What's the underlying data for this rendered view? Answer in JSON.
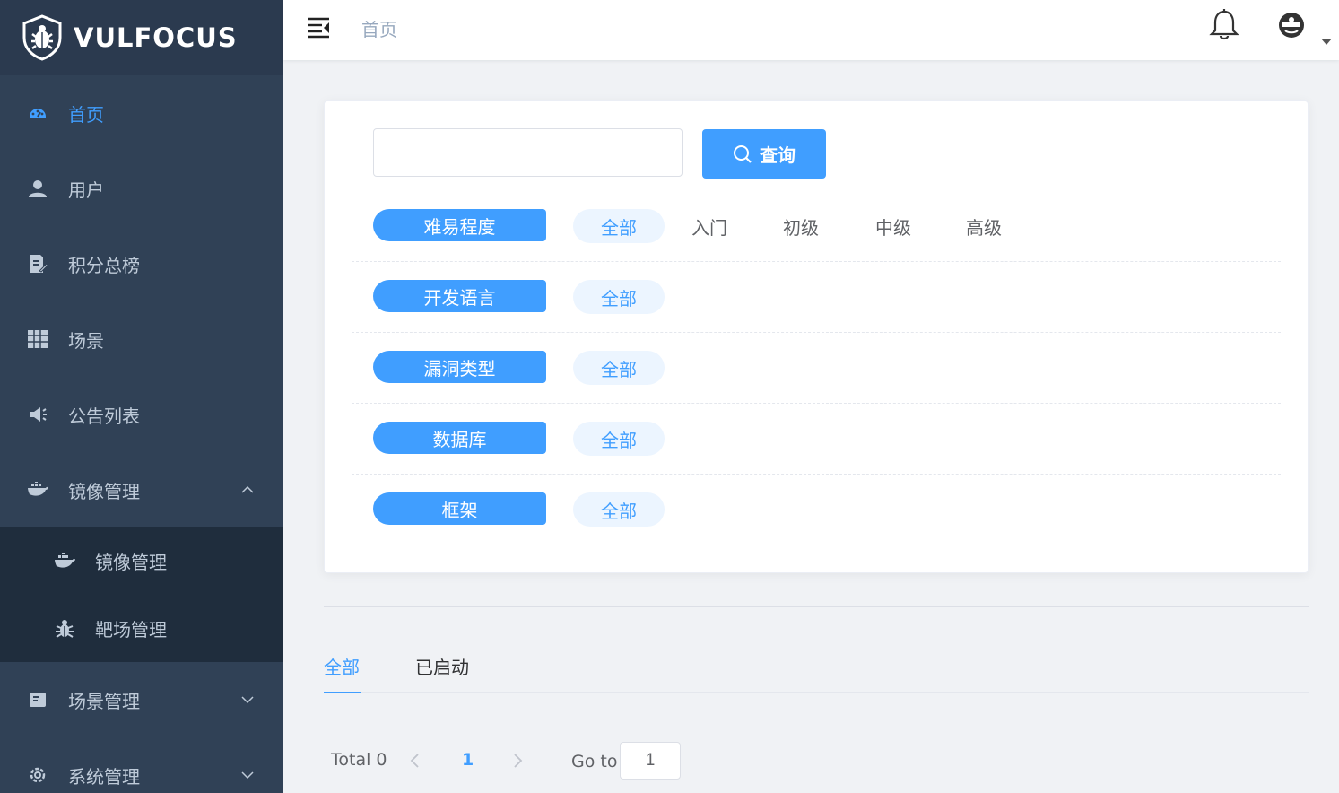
{
  "brand": {
    "name": "VULFOCUS"
  },
  "sidebar": {
    "items": [
      {
        "label": "首页",
        "icon": "dashboard-icon",
        "active": true
      },
      {
        "label": "用户",
        "icon": "user-icon"
      },
      {
        "label": "积分总榜",
        "icon": "edit-doc-icon"
      },
      {
        "label": "场景",
        "icon": "grid-icon"
      },
      {
        "label": "公告列表",
        "icon": "megaphone-icon"
      },
      {
        "label": "镜像管理",
        "icon": "docker-icon",
        "expanded": true,
        "children": [
          {
            "label": "镜像管理",
            "icon": "docker-icon"
          },
          {
            "label": "靶场管理",
            "icon": "bug-icon"
          }
        ]
      },
      {
        "label": "场景管理",
        "icon": "card-icon"
      },
      {
        "label": "系统管理",
        "icon": "gear-icon"
      }
    ]
  },
  "header": {
    "breadcrumb": "首页"
  },
  "search": {
    "value": "",
    "button_label": "查询"
  },
  "filters": [
    {
      "label": "难易程度",
      "all": "全部",
      "options": [
        "入门",
        "初级",
        "中级",
        "高级"
      ]
    },
    {
      "label": "开发语言",
      "all": "全部",
      "options": []
    },
    {
      "label": "漏洞类型",
      "all": "全部",
      "options": []
    },
    {
      "label": "数据库",
      "all": "全部",
      "options": []
    },
    {
      "label": "框架",
      "all": "全部",
      "options": []
    }
  ],
  "tabs": [
    {
      "label": "全部",
      "active": true
    },
    {
      "label": "已启动",
      "active": false
    }
  ],
  "pagination": {
    "total_text": "Total 0",
    "current_page": "1",
    "goto_label": "Go to",
    "goto_value": "1"
  },
  "colors": {
    "sidebar_bg": "#304156",
    "submenu_bg": "#1f2d3d",
    "accent": "#409eff",
    "menu_text": "#bfcbd9"
  }
}
